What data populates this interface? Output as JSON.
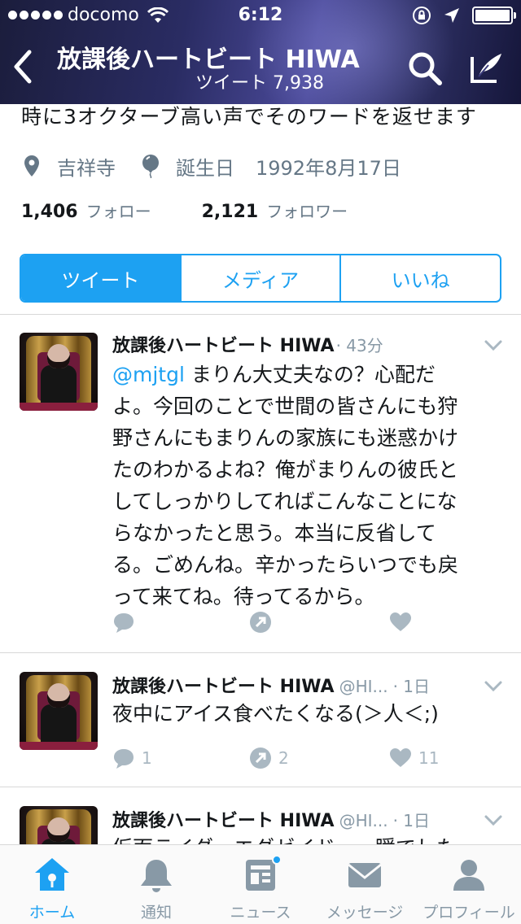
{
  "status_bar": {
    "carrier": "docomo",
    "time": "6:12"
  },
  "nav": {
    "title": "放課後ハートビート HIWA",
    "subtitle": "ツイート 7,938"
  },
  "profile": {
    "bio": "時に3オクターブ高い声でそのワードを返せます",
    "location": "吉祥寺",
    "birthday_label": "誕生日",
    "birthday": "1992年8月17日",
    "following_count": "1,406",
    "following_label": "フォロー",
    "followers_count": "2,121",
    "followers_label": "フォロワー"
  },
  "segments": [
    {
      "label": "ツイート",
      "active": true
    },
    {
      "label": "メディア",
      "active": false
    },
    {
      "label": "いいね",
      "active": false
    }
  ],
  "tweets": [
    {
      "name": "放課後ハートビート HIWA",
      "handle": "",
      "time": "· 43分",
      "mention": "@mjtgl",
      "lines": [
        " まりん大丈夫なの？心配だ",
        "よ。今回のことで世間の皆さんにも狩",
        "野さんにもまりんの家族にも迷惑かけ",
        "たのわかるよね？俺がまりんの彼氏と",
        "してしっかりしてればこんなことにな",
        "らなかったと思う。本当に反省して",
        "る。ごめんね。辛かったらいつでも戻",
        "って来てね。待ってるから。"
      ],
      "replies": "",
      "retweets": "",
      "likes": ""
    },
    {
      "name": "放課後ハートビート HIWA",
      "handle": "@HI...",
      "time": "· 1日",
      "lines": [
        "夜中にアイス食べたくなる(＞人＜;)"
      ],
      "replies": "1",
      "retweets": "2",
      "likes": "11"
    },
    {
      "name": "放課後ハートビート HIWA",
      "handle": "@HI...",
      "time": "· 1日",
      "lines": [
        "仮面ライダーエグゼイド、一瞬でした"
      ]
    }
  ],
  "tabbar": [
    {
      "label": "ホーム",
      "icon": "home-icon",
      "active": true
    },
    {
      "label": "通知",
      "icon": "bell-icon",
      "active": false
    },
    {
      "label": "ニュース",
      "icon": "news-icon",
      "active": false,
      "badge": true
    },
    {
      "label": "メッセージ",
      "icon": "envelope-icon",
      "active": false
    },
    {
      "label": "プロフィール",
      "icon": "person-icon",
      "active": false
    }
  ],
  "colors": {
    "accent": "#1da1f2",
    "muted": "#8899a6",
    "text": "#14171a"
  }
}
